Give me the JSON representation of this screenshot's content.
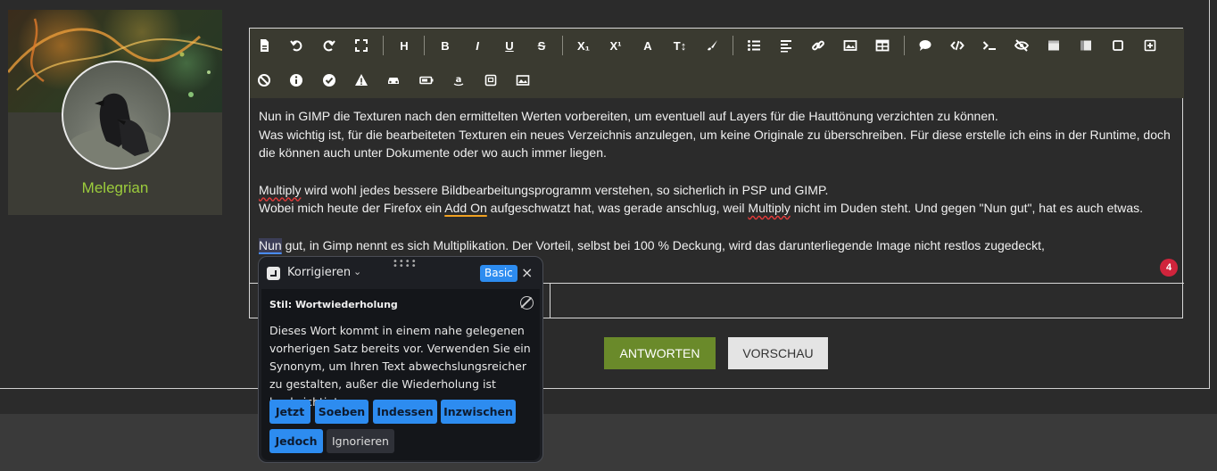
{
  "user": {
    "name": "Melegrian"
  },
  "toolbar": {
    "row1": [
      "file-icon",
      "undo-icon",
      "redo-icon",
      "fullscreen-icon",
      "heading-icon",
      "bold-icon",
      "italic-icon",
      "underline-icon",
      "strikethrough-icon",
      "subscript-icon",
      "superscript-icon",
      "font-icon",
      "font-size-icon",
      "paint-brush-icon",
      "list-icon",
      "align-left-icon",
      "link-icon",
      "image-icon",
      "table-icon",
      "comment-icon",
      "code-icon",
      "terminal-icon",
      "eye-slash-icon",
      "window-icon",
      "columns-icon",
      "square-icon",
      "plus-square-icon"
    ],
    "row2": [
      "ban-icon",
      "info-icon",
      "check-circle-icon",
      "warning-icon",
      "car-icon",
      "battery-icon",
      "amazon-icon",
      "sticky-note-icon",
      "picture-icon"
    ],
    "labels": {
      "heading": "H",
      "bold": "B",
      "italic": "I",
      "underline": "U",
      "strike": "S",
      "subscript": "X₁",
      "superscript": "X¹",
      "font": "A",
      "font_size": "T↕"
    }
  },
  "content": {
    "p1_line1": "Nun in GIMP die Texturen nach den ermittelten Werten vorbereiten, um eventuell auf Layers für die Hauttönung verzichten zu können.",
    "p1_line2": "Was wichtig ist, für die bearbeiteten Texturen ein neues Verzeichnis anzulegen, um keine Originale zu überschreiben. Für diese erstelle ich eins in der Runtime, doch die können auch unter Dokumente oder wo auch immer liegen.",
    "p2_word": "Multiply",
    "p2_rest": " wird wohl jedes bessere Bildbearbeitungsprogramm verstehen, so sicherlich in PSP und GIMP.",
    "p3_a": "Wobei mich heute der Firefox ein ",
    "p3_addon": "Add On",
    "p3_b": " aufgeschwatzt hat, was gerade anschlug, weil ",
    "p3_multiply": "Multiply",
    "p3_c": " nicht im Duden steht. Und gegen \"Nun gut\", hat es auch etwas.",
    "p4_word": "Nun",
    "p4_rest": " gut, in Gimp nennt es sich Multiplikation. Der Vorteil, selbst bei 100 % Deckung, wird das darunterliegende Image nicht restlos zugedeckt,",
    "issue_count": "4"
  },
  "actions": {
    "answer": "ANTWORTEN",
    "preview": "VORSCHAU"
  },
  "popup": {
    "title": "Korrigieren",
    "plan": "Basic",
    "rule": "Stil: Wortwiederholung",
    "message": "Dieses Wort kommt in einem nahe gelegenen vorherigen Satz bereits vor. Verwenden Sie ein Synonym, um Ihren Text abwechslungsreicher zu gestalten, außer die Wiederholung ist beabsichtigt.",
    "suggestions": [
      "Jetzt",
      "Soeben",
      "Indessen",
      "Inzwischen",
      "Jedoch"
    ],
    "ignore": "Ignorieren"
  },
  "colors": {
    "accent_green": "#6a8a2a",
    "username": "#9ccc3c",
    "badge": "#d0243c",
    "lt_blue": "#2d8cf0"
  }
}
